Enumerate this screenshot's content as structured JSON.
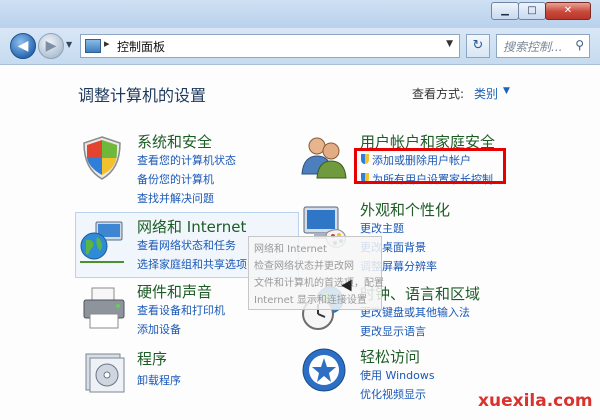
{
  "window": {
    "address": {
      "chevron": "▸",
      "path": "控制面板"
    },
    "search_placeholder": "搜索控制...",
    "buttons": {
      "minimize": "▁",
      "maximize": "□",
      "close": "✕",
      "refresh": "↻"
    }
  },
  "page": {
    "title": "调整计算机的设置",
    "view_by_label": "查看方式:",
    "view_by_value": "类别",
    "view_by_arrow": "▼"
  },
  "categories": [
    {
      "title": "系统和安全",
      "icon": "shield-icon",
      "links": [
        "查看您的计算机状态",
        "备份您的计算机",
        "查找并解决问题"
      ]
    },
    {
      "title": "网络和 Internet",
      "icon": "globe-network-icon",
      "links": [
        "查看网络状态和任务",
        "选择家庭组和共享选项"
      ]
    },
    {
      "title": "硬件和声音",
      "icon": "printer-icon",
      "links": [
        "查看设备和打印机",
        "添加设备"
      ]
    },
    {
      "title": "程序",
      "icon": "programs-icon",
      "links": [
        "卸载程序"
      ]
    },
    {
      "title": "用户帐户和家庭安全",
      "icon": "users-icon",
      "links": [
        "添加或删除用户帐户",
        "为所有用户设置家长控制"
      ]
    },
    {
      "title": "外观和个性化",
      "icon": "monitor-palette-icon",
      "links": [
        "更改主题",
        "更改桌面背景",
        "调整屏幕分辨率"
      ]
    },
    {
      "title": "时钟、语言和区域",
      "icon": "clock-globe-icon",
      "links": [
        "更改键盘或其他输入法",
        "更改显示语言"
      ]
    },
    {
      "title": "轻松访问",
      "icon": "accessibility-icon",
      "links": [
        "使用 Windows",
        "优化视频显示"
      ]
    }
  ],
  "tooltip": {
    "lines": [
      "网络和 Internet",
      "检查网络状态并更改网",
      "文件和计算机的首选项，配置",
      "Internet 显示和连接设置"
    ]
  },
  "watermark": "xuexila.com",
  "colors": {
    "link": "#1a58b5",
    "category_title": "#1d5c25",
    "highlight_box": "#e60000"
  }
}
